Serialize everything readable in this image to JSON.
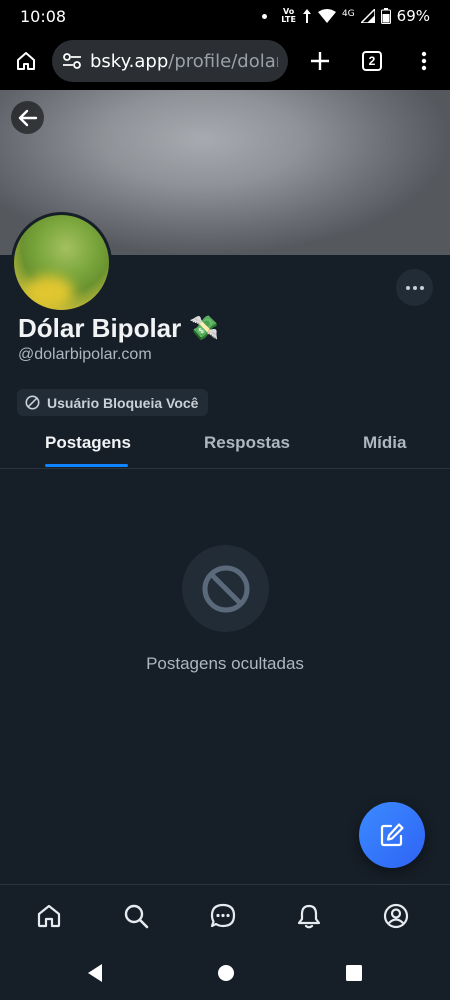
{
  "status_bar": {
    "time": "10:08",
    "volte_top": "Vo",
    "volte_bottom": "LTE",
    "network": "4G",
    "battery": "69%"
  },
  "browser": {
    "url_domain": "bsky.app",
    "url_path": "/profile/dolarbip",
    "tab_count": "2"
  },
  "profile": {
    "display_name": "Dólar Bipolar",
    "name_emoji": "💸",
    "handle": "@dolarbipolar.com",
    "blocked_label": "Usuário Bloqueia Você"
  },
  "tabs": [
    {
      "label": "Postagens",
      "active": true
    },
    {
      "label": "Respostas",
      "active": false
    },
    {
      "label": "Mídia",
      "active": false
    }
  ],
  "empty_state": {
    "text": "Postagens ocultadas",
    "icon": "ban-icon"
  },
  "bottom_nav": [
    "home-icon",
    "search-icon",
    "chat-icon",
    "bell-icon",
    "profile-icon"
  ],
  "colors": {
    "background": "#161e27",
    "accent": "#1083fe",
    "fab": "#3b8bff",
    "secondary_text": "#aeb6bf"
  }
}
